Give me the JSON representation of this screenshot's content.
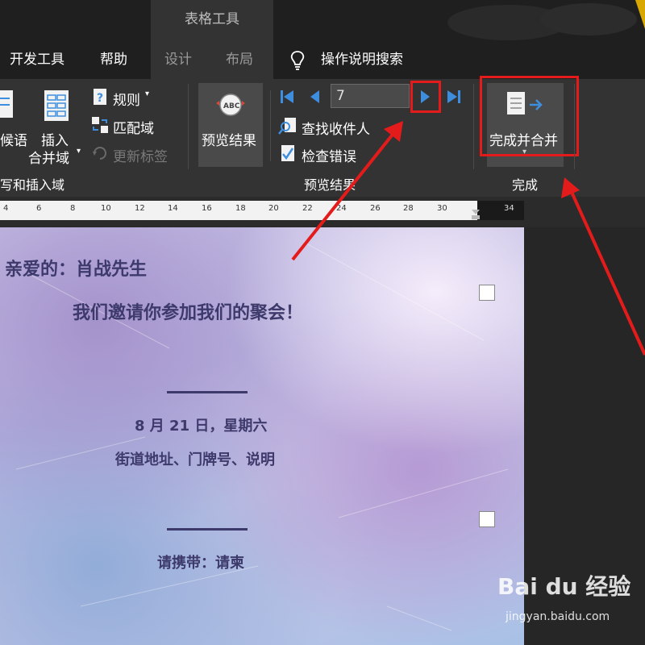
{
  "title_bar": {
    "context_tab": "表格工具"
  },
  "tabs": [
    {
      "label": "开发工具",
      "active": false
    },
    {
      "label": "帮助",
      "active": false
    },
    {
      "label": "设计",
      "active": false
    },
    {
      "label": "布局",
      "active": false
    }
  ],
  "tell_me": {
    "label": "操作说明搜索",
    "icon": "lightbulb-icon"
  },
  "ribbon": {
    "write_insert": {
      "greeting_label_partial": "候语",
      "insert_field_line1": "插入",
      "insert_field_line2": "合并域",
      "rules_label": "规则",
      "match_fields_label": "匹配域",
      "update_labels_label": "更新标签",
      "group_label_partial": "写和插入域"
    },
    "preview": {
      "preview_results_label": "预览结果",
      "record_value": "7",
      "find_recipient_label": "查找收件人",
      "check_errors_label": "检查错误",
      "group_label": "预览结果"
    },
    "finish": {
      "finish_merge_label": "完成并合并",
      "group_label": "完成"
    }
  },
  "ruler": {
    "ticks": [
      "4",
      "6",
      "8",
      "10",
      "12",
      "14",
      "16",
      "18",
      "20",
      "22",
      "24",
      "26",
      "28",
      "30",
      "34"
    ]
  },
  "document": {
    "greeting": "亲爱的：肖战先生",
    "invite": "我们邀请你参加我们的聚会！",
    "date": "8 月 21 日，星期六",
    "address": "街道地址、门牌号、说明",
    "bring": "请携带：请柬"
  },
  "watermark": {
    "brand": "Bai du 经验",
    "url": "jingyan.baidu.com"
  },
  "colors": {
    "annotation_red": "#e41b1b",
    "doc_text": "#3d3a6b",
    "nav_blue": "#3e8ede"
  }
}
